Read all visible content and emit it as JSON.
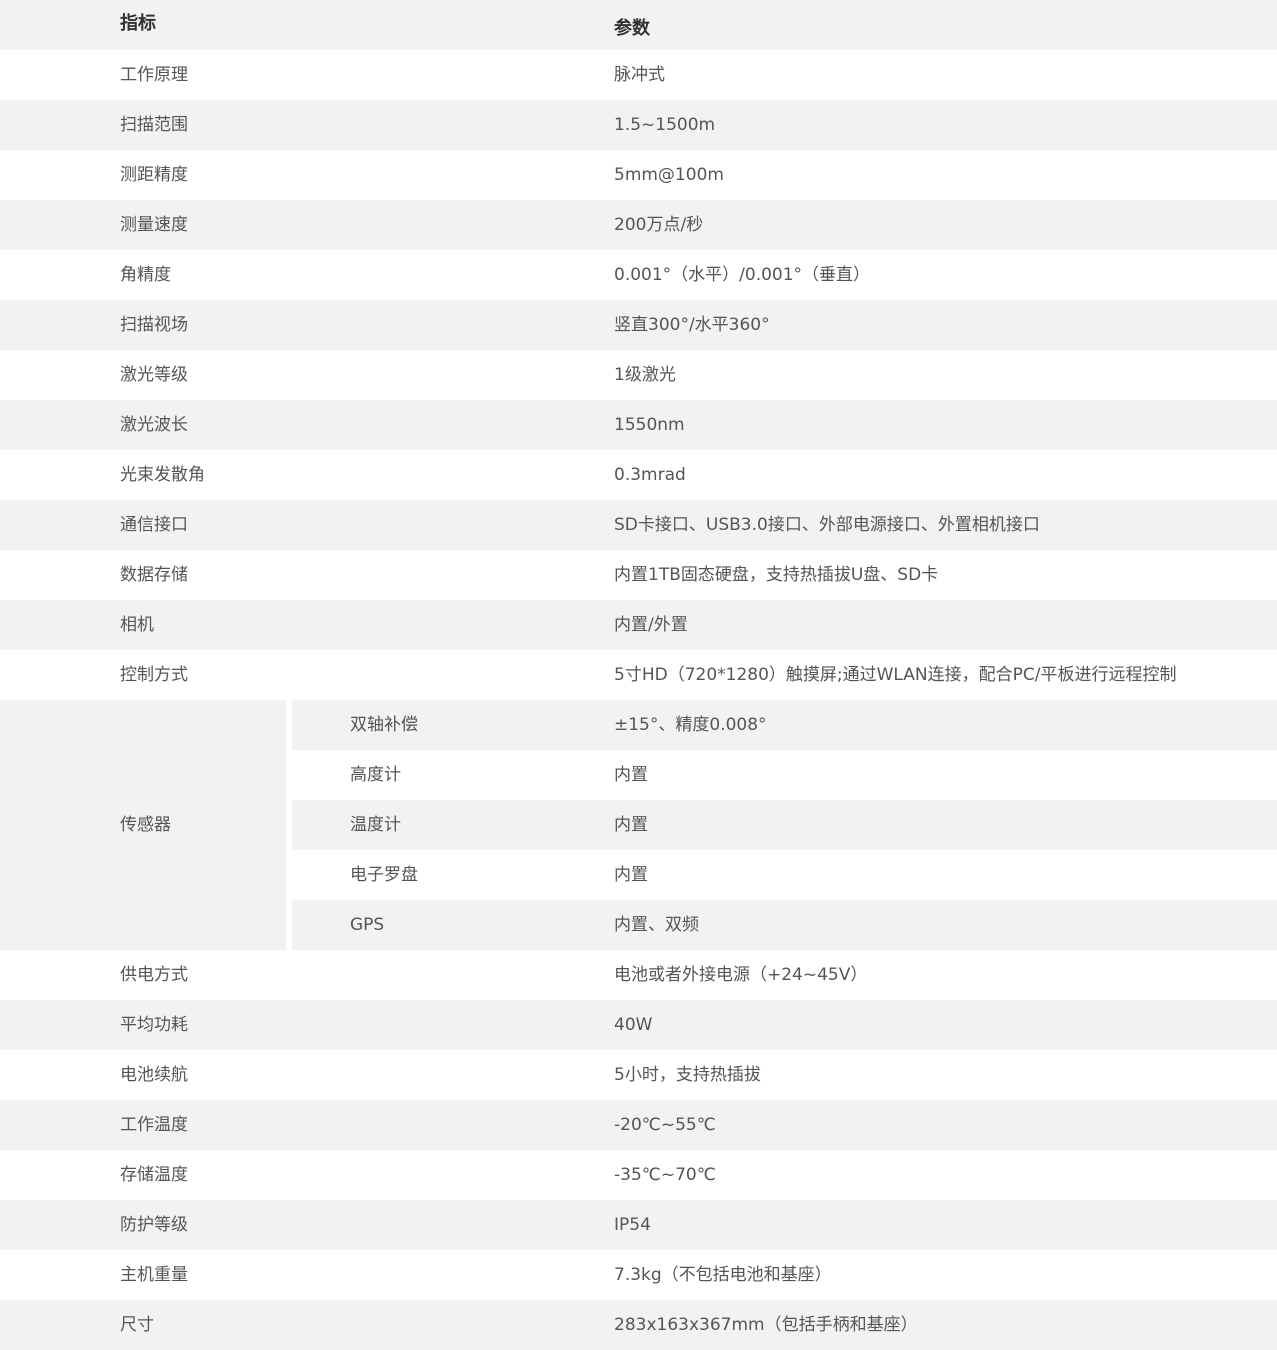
{
  "header": {
    "name": "指标",
    "value": "参数"
  },
  "rows_before": [
    {
      "name": "工作原理",
      "value": "脉冲式"
    },
    {
      "name": "扫描范围",
      "value": "1.5~1500m"
    },
    {
      "name": "测距精度",
      "value": "5mm@100m"
    },
    {
      "name": "测量速度",
      "value": "200万点/秒"
    },
    {
      "name": "角精度",
      "value": "0.001°（水平）/0.001°（垂直）"
    },
    {
      "name": "扫描视场",
      "value": "竖直300°/水平360°"
    },
    {
      "name": "激光等级",
      "value": "1级激光"
    },
    {
      "name": "激光波长",
      "value": "1550nm"
    },
    {
      "name": "光束发散角",
      "value": "0.3mrad"
    },
    {
      "name": "通信接口",
      "value": "SD卡接口、USB3.0接口、外部电源接口、外置相机接口"
    },
    {
      "name": "数据存储",
      "value": "内置1TB固态硬盘，支持热插拔U盘、SD卡"
    },
    {
      "name": "相机",
      "value": "内置/外置"
    },
    {
      "name": "控制方式",
      "value": "5寸HD（720*1280）触摸屏;通过WLAN连接，配合PC/平板进行远程控制"
    }
  ],
  "sensor_group": {
    "name": "传感器",
    "items": [
      {
        "name": "双轴补偿",
        "value": "±15°、精度0.008°"
      },
      {
        "name": "高度计",
        "value": "内置"
      },
      {
        "name": "温度计",
        "value": "内置"
      },
      {
        "name": "电子罗盘",
        "value": "内置"
      },
      {
        "name": "GPS",
        "value": "内置、双频"
      }
    ]
  },
  "rows_after": [
    {
      "name": "供电方式",
      "value": "电池或者外接电源（+24~45V）"
    },
    {
      "name": "平均功耗",
      "value": "40W"
    },
    {
      "name": "电池续航",
      "value": "5小时，支持热插拔"
    },
    {
      "name": "工作温度",
      "value": "-20℃~55℃"
    },
    {
      "name": "存储温度",
      "value": "-35℃~70℃"
    },
    {
      "name": "防护等级",
      "value": "IP54"
    },
    {
      "name": "主机重量",
      "value": "7.3kg（不包括电池和基座）"
    },
    {
      "name": "尺寸",
      "value": "283x163x367mm（包括手柄和基座）"
    }
  ]
}
